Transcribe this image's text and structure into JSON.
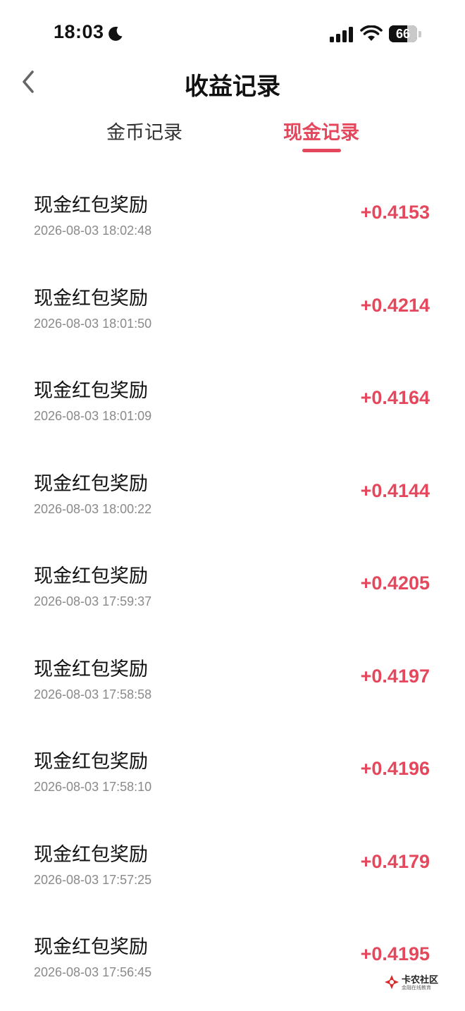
{
  "status_bar": {
    "time": "18:03",
    "battery": "66",
    "battery_percent": 66,
    "icons": [
      "moon-icon",
      "signal-icon",
      "wifi-icon",
      "battery-icon"
    ]
  },
  "header": {
    "title": "收益记录",
    "back_icon": "chevron-left-icon"
  },
  "tabs": [
    {
      "label": "金币记录",
      "active": false
    },
    {
      "label": "现金记录",
      "active": true
    }
  ],
  "colors": {
    "accent": "#e5475c",
    "text": "#111111",
    "muted": "#8a8a8a"
  },
  "records": [
    {
      "title": "现金红包奖励",
      "time": "2026-08-03 18:02:48",
      "amount": "+0.4153"
    },
    {
      "title": "现金红包奖励",
      "time": "2026-08-03 18:01:50",
      "amount": "+0.4214"
    },
    {
      "title": "现金红包奖励",
      "time": "2026-08-03 18:01:09",
      "amount": "+0.4164"
    },
    {
      "title": "现金红包奖励",
      "time": "2026-08-03 18:00:22",
      "amount": "+0.4144"
    },
    {
      "title": "现金红包奖励",
      "time": "2026-08-03 17:59:37",
      "amount": "+0.4205"
    },
    {
      "title": "现金红包奖励",
      "time": "2026-08-03 17:58:58",
      "amount": "+0.4197"
    },
    {
      "title": "现金红包奖励",
      "time": "2026-08-03 17:58:10",
      "amount": "+0.4196"
    },
    {
      "title": "现金红包奖励",
      "time": "2026-08-03 17:57:25",
      "amount": "+0.4179"
    },
    {
      "title": "现金红包奖励",
      "time": "2026-08-03 17:56:45",
      "amount": "+0.4195"
    }
  ],
  "watermark": {
    "name": "卡农社区",
    "subtitle": "金融在线教育"
  }
}
